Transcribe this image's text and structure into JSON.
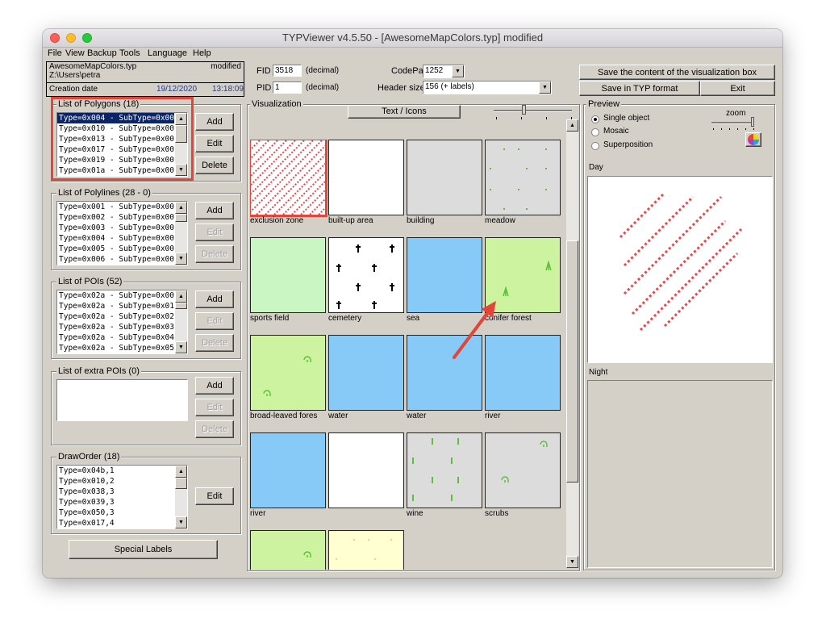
{
  "window": {
    "title": "TYPViewer v4.5.50 - [AwesomeMapColors.typ] modified"
  },
  "menu": [
    "File",
    "View",
    "Backup",
    "Tools",
    "Language",
    "Help"
  ],
  "info": {
    "filename": "AwesomeMapColors.typ",
    "status": "modified",
    "path": "Z:\\Users\\petra",
    "creation_label": "Creation date",
    "creation_date": "19/12/2020",
    "creation_time": "13:18:09"
  },
  "header": {
    "fid_label": "FID",
    "fid_value": "3518",
    "fid_unit": "(decimal)",
    "pid_label": "PID",
    "pid_value": "1",
    "pid_unit": "(decimal)",
    "codepage_label": "CodePage",
    "codepage_value": "1252",
    "headersize_label": "Header size",
    "headersize_value": "156 (+ labels)"
  },
  "top_buttons": {
    "save_visual": "Save the content of the visualization box",
    "save_typ": "Save in TYP format",
    "exit": "Exit"
  },
  "polygons": {
    "title": "List of Polygons  (18)",
    "items": [
      "Type=0x004 - SubType=0x00",
      "Type=0x010 - SubType=0x00",
      "Type=0x013 - SubType=0x00",
      "Type=0x017 - SubType=0x00",
      "Type=0x019 - SubType=0x00",
      "Type=0x01a - SubType=0x00"
    ],
    "add": "Add",
    "edit": "Edit",
    "delete": "Delete"
  },
  "polylines": {
    "title": "List of Polylines  (28 - 0)",
    "items": [
      "Type=0x001 - SubType=0x00",
      "Type=0x002 - SubType=0x00",
      "Type=0x003 - SubType=0x00",
      "Type=0x004 - SubType=0x00",
      "Type=0x005 - SubType=0x00",
      "Type=0x006 - SubType=0x00"
    ],
    "add": "Add",
    "edit": "Edit",
    "delete": "Delete"
  },
  "pois": {
    "title": "List of POIs  (52)",
    "items": [
      "Type=0x02a - SubType=0x00",
      "Type=0x02a - SubType=0x01",
      "Type=0x02a - SubType=0x02",
      "Type=0x02a - SubType=0x03",
      "Type=0x02a - SubType=0x04",
      "Type=0x02a - SubType=0x05"
    ],
    "add": "Add",
    "edit": "Edit",
    "delete": "Delete"
  },
  "extra_pois": {
    "title": "List of extra POIs  (0)",
    "add": "Add",
    "edit": "Edit",
    "delete": "Delete"
  },
  "draworder": {
    "title": "DrawOrder  (18)",
    "items": [
      "Type=0x04b,1",
      "Type=0x010,2",
      "Type=0x038,3",
      "Type=0x039,3",
      "Type=0x050,3",
      "Type=0x017,4"
    ],
    "edit": "Edit"
  },
  "special_labels": "Special Labels",
  "visualization": {
    "title": "Visualization",
    "text_icons": "Text / Icons",
    "tiles": [
      {
        "label": "exclusion zone",
        "color": "#ffffff"
      },
      {
        "label": "built-up area",
        "color": "#ffffff"
      },
      {
        "label": "building",
        "color": "#dcdcdc"
      },
      {
        "label": "meadow",
        "color": "#dcdcdc"
      },
      {
        "label": "sports field",
        "color": "#c9f6c3"
      },
      {
        "label": "cemetery",
        "color": "#ffffff"
      },
      {
        "label": "sea",
        "color": "#87c9f7"
      },
      {
        "label": "conifer forest",
        "color": "#cdf3a0"
      },
      {
        "label": "broad-leaved fores",
        "color": "#cdf3a0"
      },
      {
        "label": "water",
        "color": "#87c9f7"
      },
      {
        "label": "water",
        "color": "#87c9f7"
      },
      {
        "label": "river",
        "color": "#87c9f7"
      },
      {
        "label": "river",
        "color": "#87c9f7"
      },
      {
        "label": "",
        "color": "#ffffff"
      },
      {
        "label": "wine",
        "color": "#dcdcdc"
      },
      {
        "label": "scrubs",
        "color": "#dcdcdc"
      },
      {
        "label": "",
        "color": "#cdf3a0"
      },
      {
        "label": "",
        "color": "#ffffd2"
      }
    ]
  },
  "preview": {
    "title": "Preview",
    "options": [
      "Single object",
      "Mosaic",
      "Superposition"
    ],
    "zoom_label": "zoom",
    "day_label": "Day",
    "night_label": "Night"
  },
  "colors": {
    "highlight": "#e4453a",
    "selection": "#0a246a",
    "pattern_red": "#f0454a",
    "green_icon": "#5fbf3a"
  }
}
